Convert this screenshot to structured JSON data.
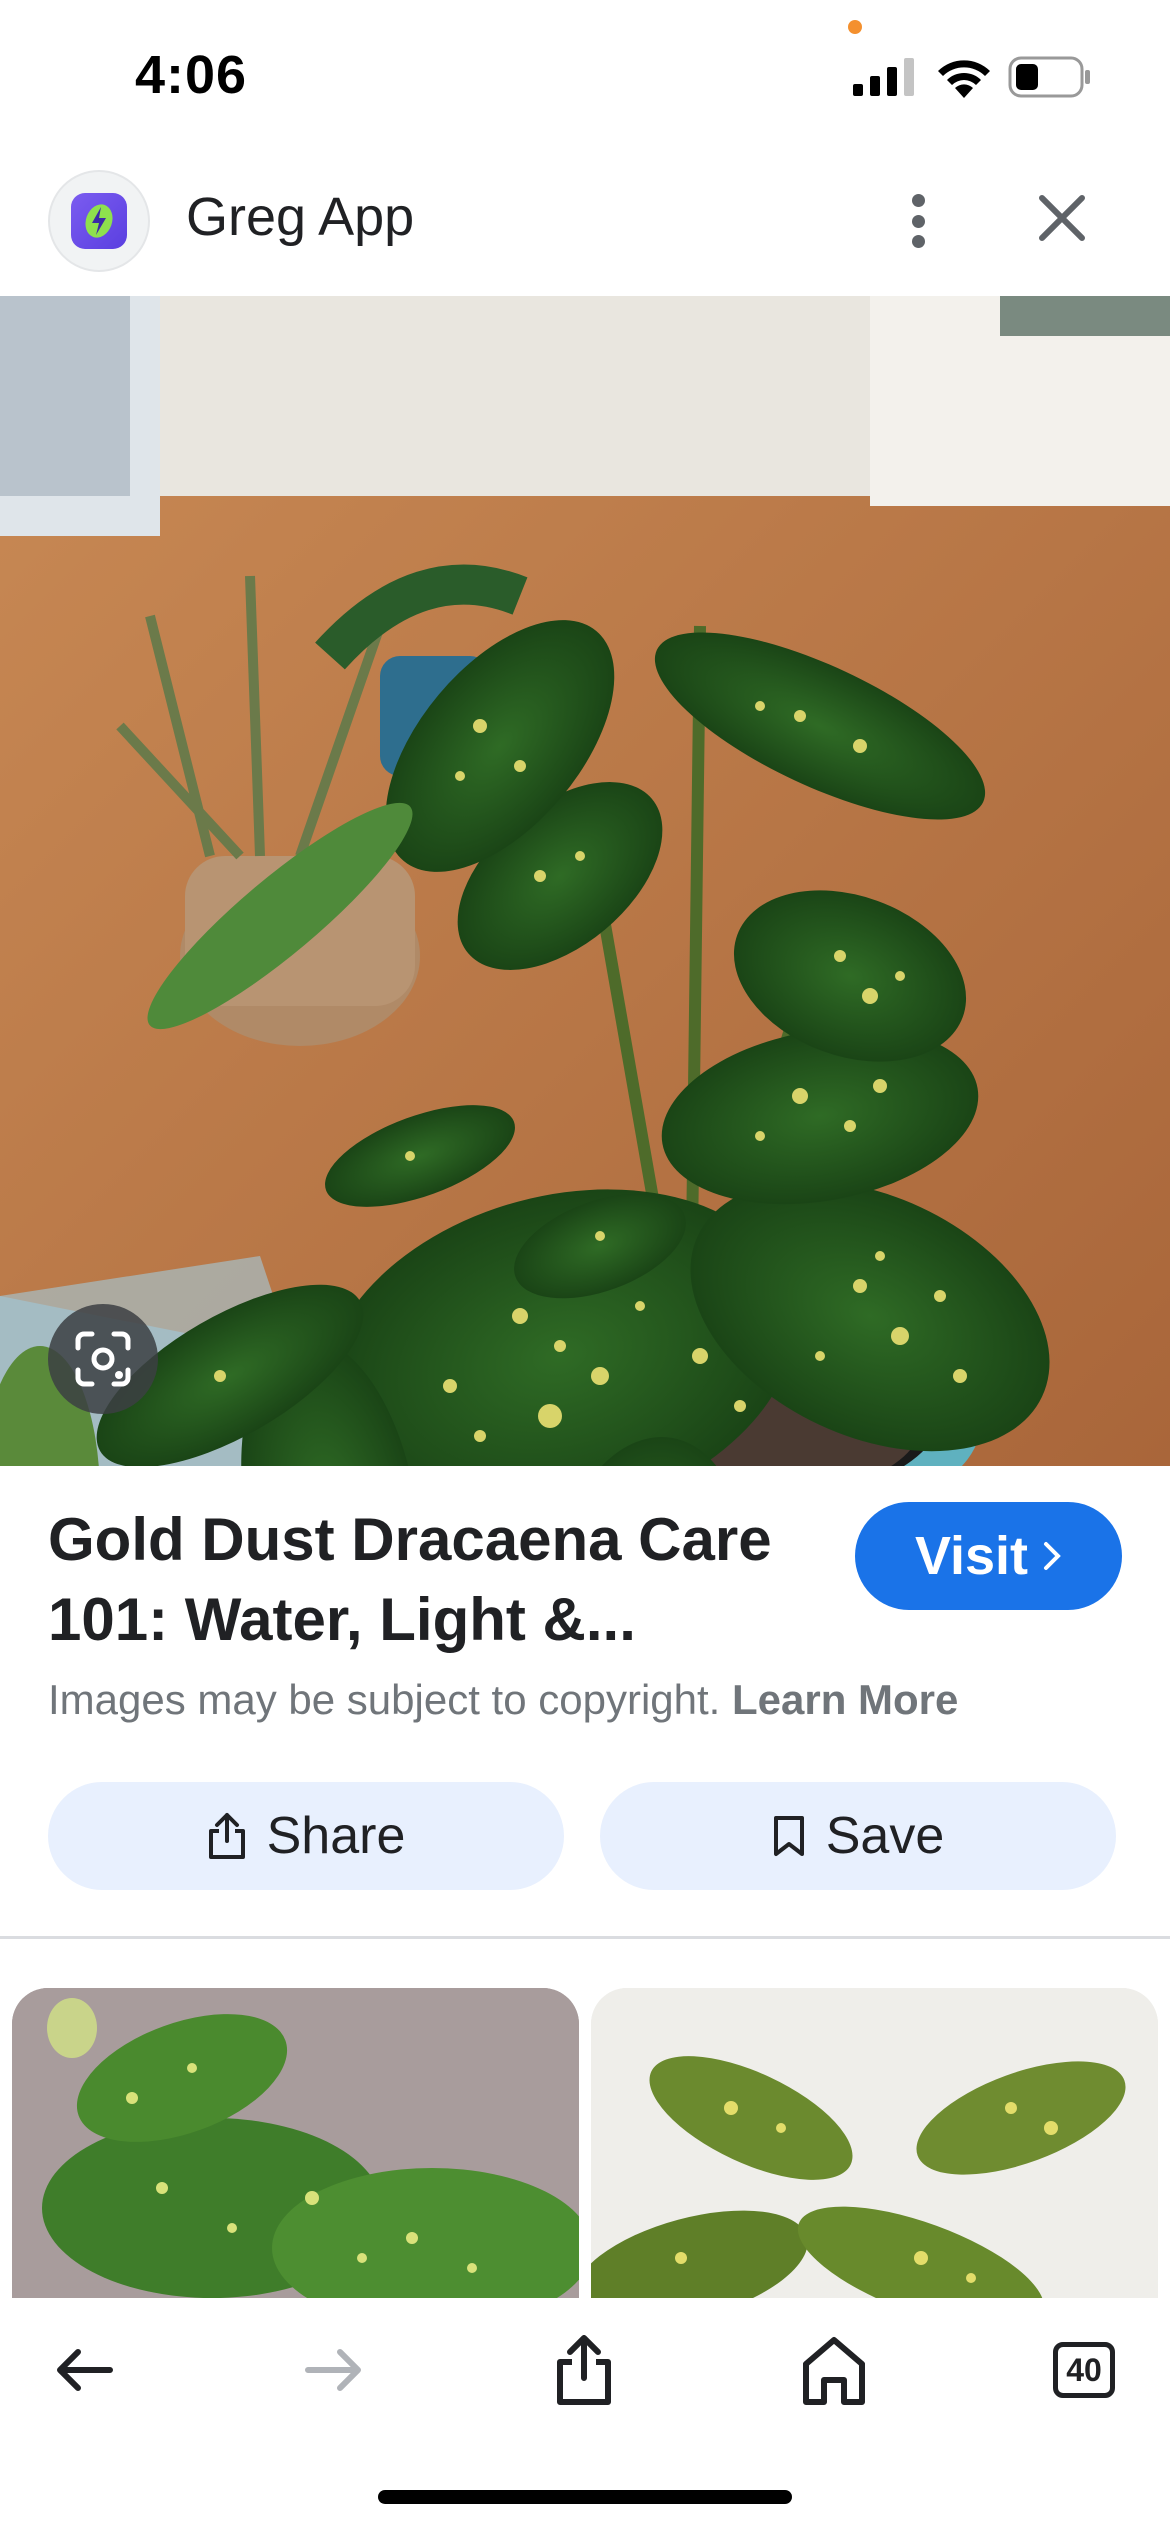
{
  "status_bar": {
    "time": "4:06",
    "icons": [
      "signal-icon",
      "wifi-icon",
      "battery-icon"
    ],
    "battery_level": 0.3
  },
  "header": {
    "app_title": "Greg App",
    "logo_icon": "leaf-bolt-icon",
    "menu_icon": "more-vert-icon",
    "close_icon": "close-icon"
  },
  "image": {
    "lens_icon": "lens-icon"
  },
  "result": {
    "title": "Gold Dust Dracaena Care 101: Water, Light &...",
    "visit_label": "Visit",
    "copyright_text": "Images may be subject to copyright.",
    "learn_more": "Learn More"
  },
  "actions": {
    "share_label": "Share",
    "save_label": "Save"
  },
  "toolbar": {
    "tabs_count": "40",
    "icons": [
      "back-arrow-icon",
      "forward-arrow-icon",
      "share-icon",
      "home-icon",
      "tabs-icon"
    ]
  },
  "colors": {
    "accent": "#1a73e8",
    "chip_bg": "#e8f0fe",
    "text": "#202124",
    "secondary_text": "#70757a"
  }
}
